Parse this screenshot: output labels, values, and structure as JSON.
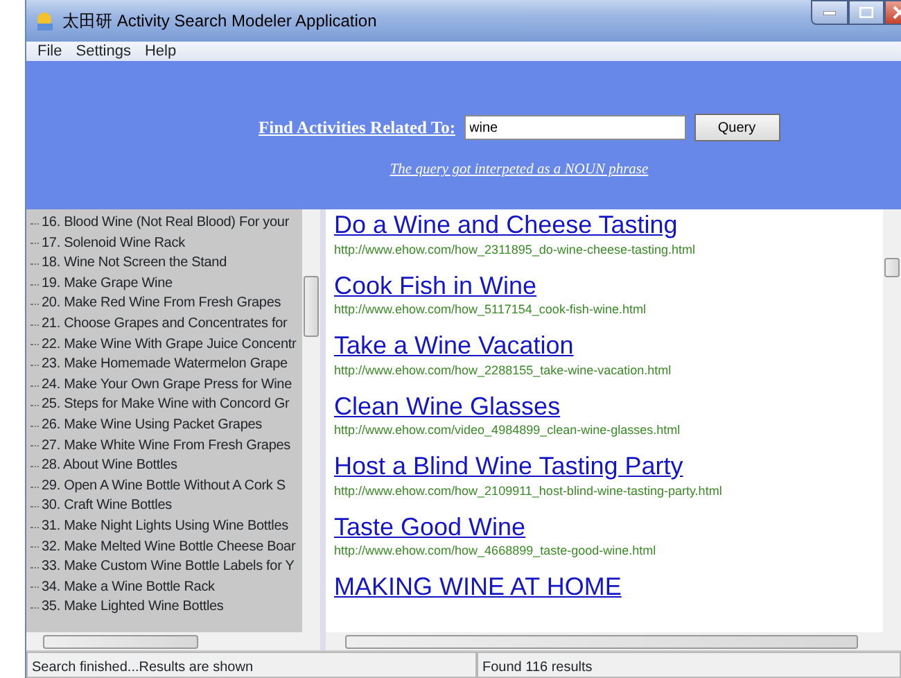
{
  "window": {
    "title": "太田研 Activity Search Modeler Application"
  },
  "menu": [
    "File",
    "Settings",
    "Help"
  ],
  "query": {
    "label": "Find Activities Related To:",
    "value": "wine",
    "button": "Query",
    "note": "The query got interpeted as a NOUN phrase"
  },
  "tree": {
    "items": [
      {
        "label": "16. Blood Wine (Not Real Blood) For your"
      },
      {
        "label": "17. Solenoid Wine Rack"
      },
      {
        "label": "18. Wine Not Screen the Stand"
      },
      {
        "label": "19. Make Grape Wine"
      },
      {
        "label": "20. Make Red Wine From Fresh Grapes"
      },
      {
        "label": "21. Choose Grapes and Concentrates for"
      },
      {
        "label": "22. Make Wine With Grape Juice Concentr"
      },
      {
        "label": "23. Make Homemade Watermelon Grape"
      },
      {
        "label": "24. Make Your Own Grape Press for Wine"
      },
      {
        "label": "25. Steps for Make Wine with Concord Gr"
      },
      {
        "label": "26. Make Wine Using Packet Grapes"
      },
      {
        "label": "27. Make White Wine From Fresh Grapes"
      },
      {
        "label": "28. About Wine Bottles"
      },
      {
        "label": "29. Open A Wine Bottle Without A Cork S"
      },
      {
        "label": "30. Craft Wine Bottles"
      },
      {
        "label": "31. Make Night Lights Using Wine Bottles"
      },
      {
        "label": "32. Make Melted Wine Bottle Cheese Boar"
      },
      {
        "label": "33. Make Custom Wine Bottle Labels for Y"
      },
      {
        "label": "34. Make a Wine Bottle Rack"
      },
      {
        "label": "35. Make Lighted Wine Bottles"
      }
    ]
  },
  "results": [
    {
      "title": "Do a Wine and Cheese Tasting",
      "url": "http://www.ehow.com/how_2311895_do-wine-cheese-tasting.html"
    },
    {
      "title": "Cook Fish in Wine",
      "url": "http://www.ehow.com/how_5117154_cook-fish-wine.html"
    },
    {
      "title": "Take a Wine Vacation",
      "url": "http://www.ehow.com/how_2288155_take-wine-vacation.html"
    },
    {
      "title": "Clean Wine Glasses",
      "url": "http://www.ehow.com/video_4984899_clean-wine-glasses.html"
    },
    {
      "title": "Host a Blind Wine Tasting Party",
      "url": "http://www.ehow.com/how_2109911_host-blind-wine-tasting-party.html"
    },
    {
      "title": "Taste Good Wine",
      "url": "http://www.ehow.com/how_4668899_taste-good-wine.html"
    },
    {
      "title": "MAKING WINE AT HOME"
    }
  ],
  "status_bar": [
    "Search finished...Results are shown",
    "Found 116 results"
  ]
}
